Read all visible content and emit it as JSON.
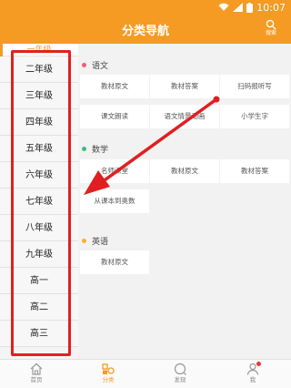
{
  "status_bar": {
    "time": "10:07"
  },
  "header": {
    "title": "分类导航",
    "search_label": "搜索"
  },
  "sidebar": {
    "partial_label": "一年级",
    "items": [
      "二年级",
      "三年级",
      "四年级",
      "五年级",
      "六年级",
      "七年级",
      "八年级",
      "九年级",
      "高一",
      "高二",
      "高三"
    ]
  },
  "sections": [
    {
      "title": "语文",
      "dot_color": "#f15b7a",
      "cells": [
        "教材原文",
        "教材答案",
        "扫码报听写",
        "课文朗读",
        "语文情景动画",
        "小学生字"
      ]
    },
    {
      "title": "数学",
      "dot_color": "#3cbf7a",
      "cells": [
        "名师课堂",
        "教材原文",
        "教材答案",
        "从课本到奥数"
      ]
    },
    {
      "title": "英语",
      "dot_color": "#f5b035",
      "cells": [
        "教材原文"
      ]
    }
  ],
  "tabbar": {
    "items": [
      {
        "label": "首页",
        "icon": "home-icon",
        "active": false
      },
      {
        "label": "分类",
        "icon": "category-icon",
        "active": true
      },
      {
        "label": "发现",
        "icon": "discover-icon",
        "active": false
      },
      {
        "label": "我",
        "icon": "profile-icon",
        "active": false
      }
    ]
  },
  "colors": {
    "accent": "#f59a23",
    "annotation": "#e02020",
    "badge": "#e53935"
  }
}
